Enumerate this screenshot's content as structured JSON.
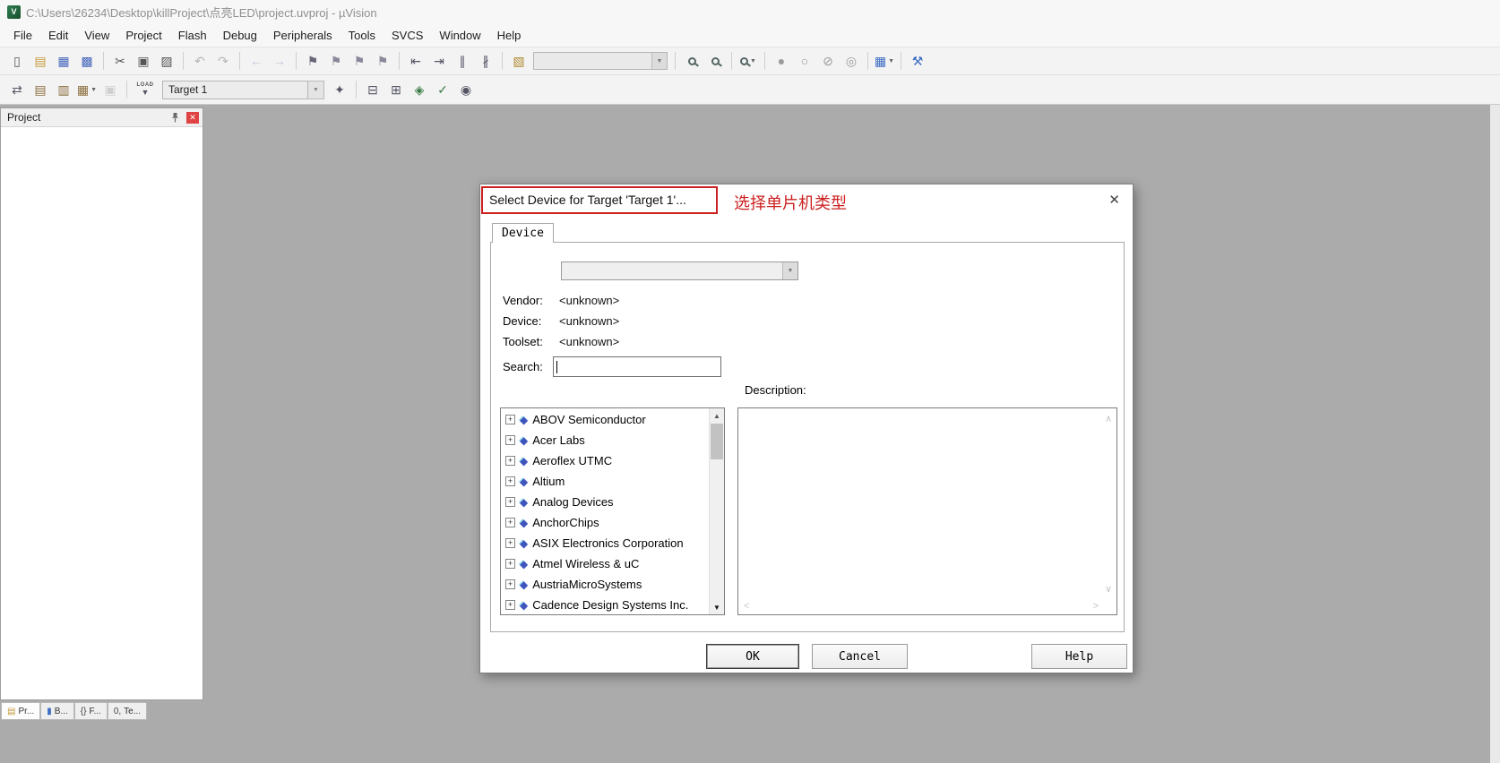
{
  "window": {
    "title": "C:\\Users\\26234\\Desktop\\killProject\\点亮LED\\project.uvproj - µVision"
  },
  "menu": {
    "items": [
      "File",
      "Edit",
      "View",
      "Project",
      "Flash",
      "Debug",
      "Peripherals",
      "Tools",
      "SVCS",
      "Window",
      "Help"
    ]
  },
  "toolbar1": {
    "icons": [
      {
        "name": "new-file-icon",
        "glyph": "▯",
        "color": "#555"
      },
      {
        "name": "open-file-icon",
        "glyph": "▤",
        "color": "#c79b3b"
      },
      {
        "name": "save-icon",
        "glyph": "▦",
        "color": "#4466bb"
      },
      {
        "name": "save-all-icon",
        "glyph": "▩",
        "color": "#4466bb"
      },
      {
        "type": "sep"
      },
      {
        "name": "cut-icon",
        "glyph": "✂",
        "color": "#555"
      },
      {
        "name": "copy-icon",
        "glyph": "▣",
        "color": "#555"
      },
      {
        "name": "paste-icon",
        "glyph": "▨",
        "color": "#555"
      },
      {
        "type": "sep"
      },
      {
        "name": "undo-icon",
        "glyph": "↶",
        "color": "#777",
        "disabled": true
      },
      {
        "name": "redo-icon",
        "glyph": "↷",
        "color": "#777",
        "disabled": true
      },
      {
        "type": "sep"
      },
      {
        "name": "navigate-back-icon",
        "glyph": "←",
        "color": "#8898c0",
        "disabled": true
      },
      {
        "name": "navigate-forward-icon",
        "glyph": "→",
        "color": "#8898c0",
        "disabled": true
      },
      {
        "type": "sep"
      },
      {
        "name": "bookmark-toggle-icon",
        "glyph": "⚑",
        "color": "#667"
      },
      {
        "name": "bookmark-prev-icon",
        "glyph": "⚑",
        "color": "#889"
      },
      {
        "name": "bookmark-next-icon",
        "glyph": "⚑",
        "color": "#889"
      },
      {
        "name": "bookmark-clear-icon",
        "glyph": "⚑",
        "color": "#889"
      },
      {
        "type": "sep"
      },
      {
        "name": "outdent-icon",
        "glyph": "⇤",
        "color": "#556"
      },
      {
        "name": "indent-icon",
        "glyph": "⇥",
        "color": "#556"
      },
      {
        "name": "comment-icon",
        "glyph": "∥",
        "color": "#556"
      },
      {
        "name": "uncomment-icon",
        "glyph": "∦",
        "color": "#556"
      },
      {
        "type": "sep"
      },
      {
        "name": "configure-icon",
        "glyph": "▧",
        "color": "#b08a2e"
      },
      {
        "type": "combo",
        "name": "toolbar-find-combo"
      },
      {
        "type": "sep"
      },
      {
        "name": "find-in-files-icon",
        "type": "magnifier"
      },
      {
        "name": "find-icon",
        "type": "magnifier"
      },
      {
        "type": "sep"
      },
      {
        "name": "zoom-icon",
        "type": "magnifier",
        "dropdown": true
      },
      {
        "type": "sep"
      },
      {
        "name": "breakpoint-insert-icon",
        "glyph": "●",
        "color": "#9a9a9a"
      },
      {
        "name": "breakpoint-disable-icon",
        "glyph": "○",
        "color": "#9a9a9a"
      },
      {
        "name": "breakpoint-kill-icon",
        "glyph": "⊘",
        "color": "#9a9a9a"
      },
      {
        "name": "breakpoint-enable-icon",
        "glyph": "◎",
        "color": "#9a9a9a"
      },
      {
        "type": "sep"
      },
      {
        "name": "window-layout-icon",
        "glyph": "▦",
        "color": "#3d6cc4",
        "dropdown": true
      },
      {
        "type": "sep"
      },
      {
        "name": "wrench-icon",
        "glyph": "⚒",
        "color": "#3d6cc4"
      }
    ]
  },
  "toolbar2": {
    "target_value": "Target 1",
    "icons_left": [
      {
        "name": "translate-file-icon",
        "glyph": "⇄",
        "color": "#556"
      },
      {
        "name": "build-icon",
        "glyph": "▤",
        "color": "#8a6d3b"
      },
      {
        "name": "rebuild-all-icon",
        "glyph": "▥",
        "color": "#8a6d3b"
      },
      {
        "name": "batch-build-icon",
        "glyph": "▦",
        "color": "#8a6d3b",
        "dropdown": true
      },
      {
        "name": "stop-build-icon",
        "glyph": "▣",
        "color": "#aaaaaa",
        "disabled": true
      },
      {
        "type": "sep"
      },
      {
        "name": "download-icon",
        "type": "load",
        "label": "LOAD"
      }
    ],
    "icons_right": [
      {
        "name": "options-for-target-icon",
        "glyph": "✦",
        "color": "#556"
      },
      {
        "type": "sep"
      },
      {
        "name": "manage-project-items-icon",
        "glyph": "⊟",
        "color": "#556"
      },
      {
        "name": "manage-books-icon",
        "glyph": "⊞",
        "color": "#556"
      },
      {
        "name": "manage-rte-icon",
        "glyph": "◈",
        "color": "#3a7d44"
      },
      {
        "name": "select-software-packs-icon",
        "glyph": "✓",
        "color": "#3a7d44"
      },
      {
        "name": "pack-installer-icon",
        "glyph": "◉",
        "color": "#556"
      }
    ]
  },
  "project_panel": {
    "title": "Project"
  },
  "bottom_tabs": {
    "items": [
      {
        "name": "tab-project",
        "icon_name": "project-tab-icon",
        "icon_glyph": "▤",
        "icon_color": "#c79b3b",
        "label": "Pr..."
      },
      {
        "name": "tab-books",
        "icon_name": "books-tab-icon",
        "icon_glyph": "▮",
        "icon_color": "#3d6cc4",
        "label": "B..."
      },
      {
        "name": "tab-functions",
        "icon_name": "functions-tab-icon",
        "icon_glyph": "{}",
        "icon_color": "#444",
        "label": "F..."
      },
      {
        "name": "tab-templates",
        "icon_name": "templates-tab-icon",
        "icon_glyph": "0,",
        "icon_color": "#444",
        "label": "Te..."
      }
    ]
  },
  "dialog": {
    "title": "Select Device for Target 'Target 1'...",
    "annotation": "选择单片机类型",
    "tab_label": "Device",
    "fields": [
      {
        "label": "Vendor:",
        "value": "<unknown>"
      },
      {
        "label": "Device:",
        "value": "<unknown>"
      },
      {
        "label": "Toolset:",
        "value": "<unknown>"
      }
    ],
    "search_label": "Search:",
    "search_value": "",
    "description_label": "Description:",
    "vendors": [
      "ABOV Semiconductor",
      "Acer Labs",
      "Aeroflex UTMC",
      "Altium",
      "Analog Devices",
      "AnchorChips",
      "ASIX Electronics Corporation",
      "Atmel Wireless & uC",
      "AustriaMicroSystems",
      "Cadence Design Systems Inc."
    ],
    "buttons": {
      "ok": "OK",
      "cancel": "Cancel",
      "help": "Help"
    }
  },
  "glyphs": {
    "app_icon_text": "V",
    "close": "✕",
    "dropdown": "▼",
    "scroll_up": "▲",
    "scroll_down": "▼",
    "caret_up": "∧",
    "caret_down": "∨",
    "caret_left": "<",
    "caret_right": ">",
    "plus": "+",
    "diamond": "◆"
  }
}
